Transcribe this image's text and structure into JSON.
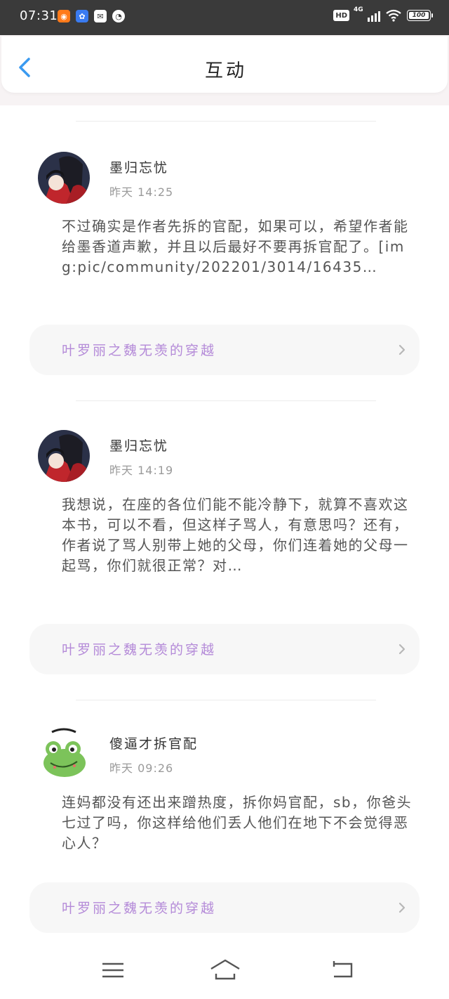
{
  "status_bar": {
    "time": "07:31",
    "apps": [
      {
        "name": "kuaishou-icon",
        "glyph": "◉"
      },
      {
        "name": "baidu-icon",
        "glyph": "✿"
      },
      {
        "name": "mail-icon",
        "glyph": "✉"
      },
      {
        "name": "speed-icon",
        "glyph": "◔"
      }
    ],
    "hd_label": "HD",
    "network_label": "4G",
    "battery_label": "100"
  },
  "header": {
    "title": "互动"
  },
  "posts": [
    {
      "username": "墨归忘忧",
      "time": "昨天 14:25",
      "content": "不过确实是作者先拆的官配，如果可以，希望作者能给墨香道声歉，并且以后最好不要再拆官配了。[img:pic/community/202201/3014/16435…",
      "book": "叶罗丽之魏无羡的穿越"
    },
    {
      "username": "墨归忘忧",
      "time": "昨天 14:19",
      "content": "我想说，在座的各位们能不能冷静下，就算不喜欢这本书，可以不看，但这样子骂人，有意思吗？还有，作者说了骂人别带上她的父母，你们连着她的父母一起骂，你们就很正常？对…",
      "book": "叶罗丽之魏无羡的穿越"
    },
    {
      "username": "傻逼才拆官配",
      "time": "昨天 09:26",
      "content": "连妈都没有还出来蹭热度，拆你妈官配，sb，你爸头七过了吗，你这样给他们丢人他们在地下不会觉得恶心人？",
      "book": "叶罗丽之魏无羡的穿越"
    }
  ],
  "colors": {
    "accent_back": "#3a9af0",
    "book_link_text": "#b48ad8",
    "status_bar_bg": "#3a3a3a"
  }
}
